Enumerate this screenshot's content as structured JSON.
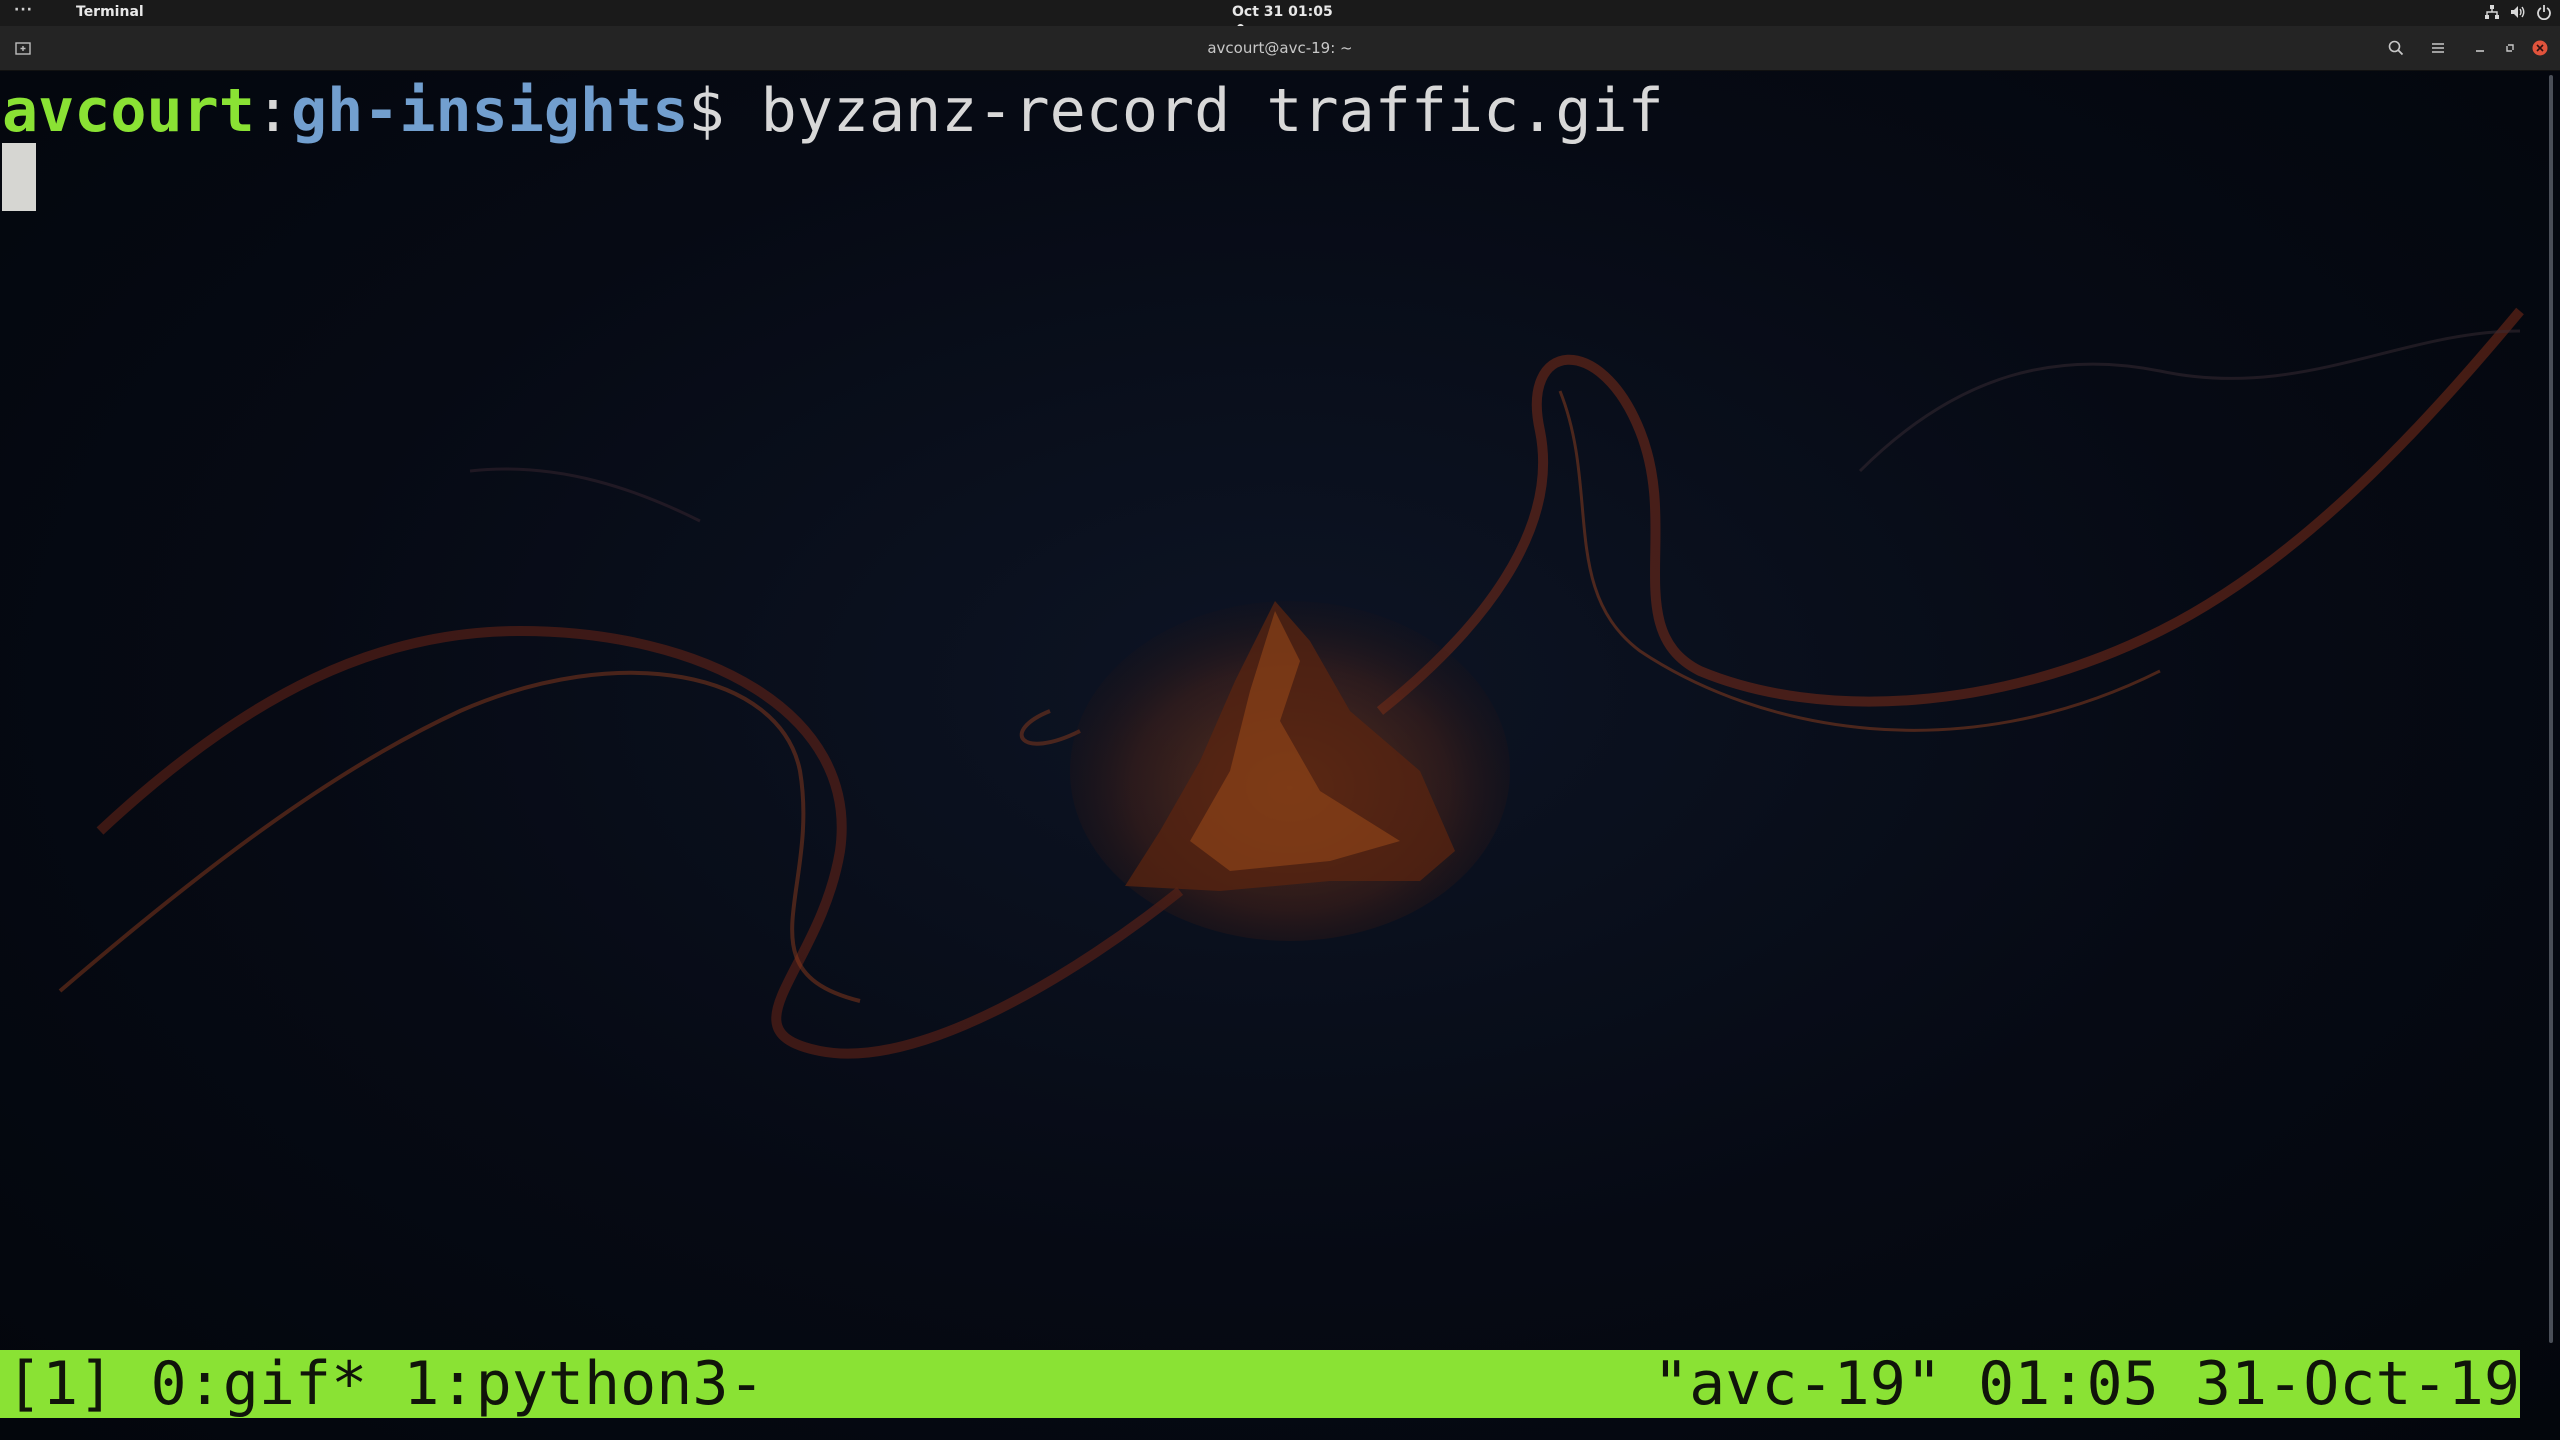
{
  "topbar": {
    "activities": "···",
    "app_name": "Terminal",
    "clock": "Oct 31  01:05",
    "tray_icons": [
      "network-icon",
      "volume-icon",
      "power-icon"
    ]
  },
  "window": {
    "title": "avcourt@avc-19: ~",
    "header_icons": [
      "new-tab-icon",
      "search-icon",
      "hamburger-menu-icon",
      "minimize-icon",
      "maximize-icon",
      "close-icon"
    ]
  },
  "terminal": {
    "prompt_user": "avcourt",
    "prompt_colon": ":",
    "prompt_dir": "gh-insights",
    "prompt_dollar": "$ ",
    "command": "byzanz-record traffic.gif"
  },
  "tmux": {
    "left": "[1] 0:gif* 1:python3-",
    "right": "\"avc-19\" 01:05 31-Oct-19"
  },
  "colors": {
    "prompt_user": "#8ae234",
    "prompt_dir": "#729fcf",
    "status_bar": "#8ae234",
    "close_button": "#e0533c",
    "background": "#05080f"
  }
}
